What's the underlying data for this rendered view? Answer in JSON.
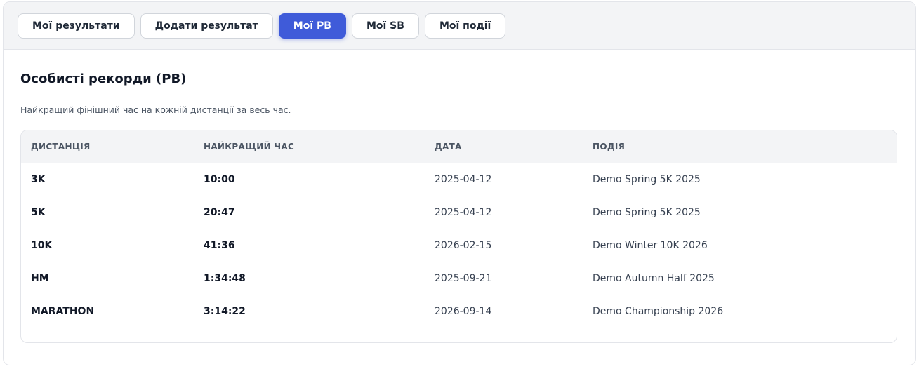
{
  "tabs": [
    {
      "label": "Мої результати",
      "active": false
    },
    {
      "label": "Додати результат",
      "active": false
    },
    {
      "label": "Мої PB",
      "active": true
    },
    {
      "label": "Мої SB",
      "active": false
    },
    {
      "label": "Мої події",
      "active": false
    }
  ],
  "page": {
    "title": "Особисті рекорди (PB)",
    "subtitle": "Найкращий фінішний час на кожній дистанції за весь час."
  },
  "table": {
    "headers": [
      "ДИСТАНЦІЯ",
      "НАЙКРАЩИЙ ЧАС",
      "ДАТА",
      "ПОДІЯ"
    ],
    "rows": [
      {
        "distance": "3K",
        "time": "10:00",
        "date": "2025-04-12",
        "event": "Demo Spring 5K 2025"
      },
      {
        "distance": "5K",
        "time": "20:47",
        "date": "2025-04-12",
        "event": "Demo Spring 5K 2025"
      },
      {
        "distance": "10K",
        "time": "41:36",
        "date": "2026-02-15",
        "event": "Demo Winter 10K 2026"
      },
      {
        "distance": "HM",
        "time": "1:34:48",
        "date": "2025-09-21",
        "event": "Demo Autumn Half 2025"
      },
      {
        "distance": "MARATHON",
        "time": "3:14:22",
        "date": "2026-09-14",
        "event": "Demo Championship 2026"
      }
    ]
  },
  "colors": {
    "accent": "#3f5bd9",
    "tabbar_bg": "#f3f4f6",
    "border": "#e3e5ea"
  }
}
